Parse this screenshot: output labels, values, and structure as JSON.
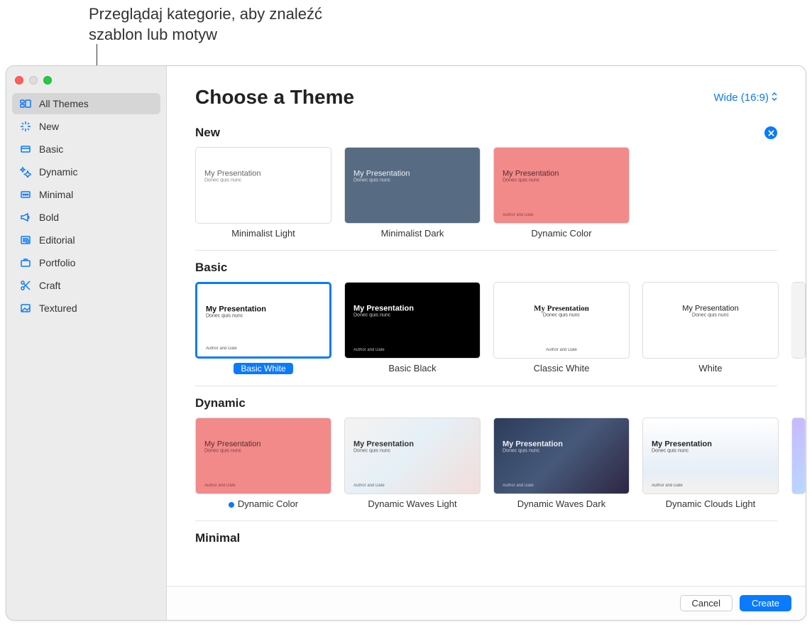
{
  "annotation": "Przeglądaj kategorie, aby znaleźć szablon lub motyw",
  "header": {
    "title": "Choose a Theme",
    "aspect": "Wide (16:9)"
  },
  "sidebar": {
    "items": [
      {
        "label": "All Themes"
      },
      {
        "label": "New"
      },
      {
        "label": "Basic"
      },
      {
        "label": "Dynamic"
      },
      {
        "label": "Minimal"
      },
      {
        "label": "Bold"
      },
      {
        "label": "Editorial"
      },
      {
        "label": "Portfolio"
      },
      {
        "label": "Craft"
      },
      {
        "label": "Textured"
      }
    ]
  },
  "slide": {
    "title": "My Presentation",
    "sub": "Donec quis nunc",
    "author": "Author and Date"
  },
  "sections": {
    "new": {
      "title": "New",
      "items": [
        {
          "label": "Minimalist Light"
        },
        {
          "label": "Minimalist Dark"
        },
        {
          "label": "Dynamic Color"
        }
      ]
    },
    "basic": {
      "title": "Basic",
      "items": [
        {
          "label": "Basic White"
        },
        {
          "label": "Basic Black"
        },
        {
          "label": "Classic White"
        },
        {
          "label": "White"
        }
      ]
    },
    "dynamic": {
      "title": "Dynamic",
      "items": [
        {
          "label": "Dynamic Color"
        },
        {
          "label": "Dynamic Waves Light"
        },
        {
          "label": "Dynamic Waves Dark"
        },
        {
          "label": "Dynamic Clouds Light"
        }
      ]
    },
    "minimal": {
      "title": "Minimal"
    }
  },
  "footer": {
    "cancel": "Cancel",
    "create": "Create"
  }
}
